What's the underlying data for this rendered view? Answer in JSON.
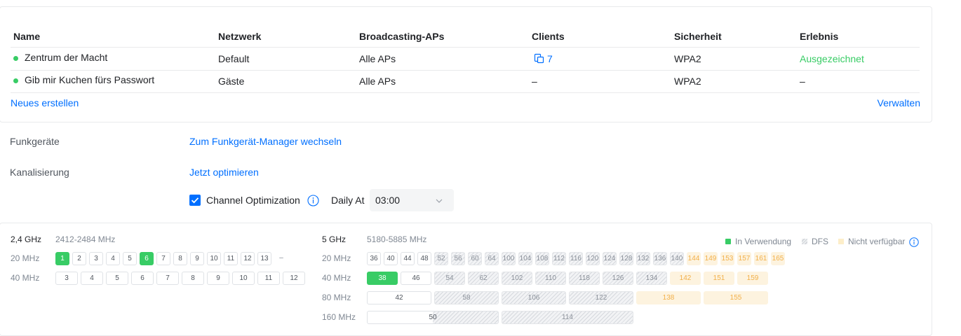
{
  "wifi_table": {
    "headers": {
      "name": "Name",
      "network": "Netzwerk",
      "aps": "Broadcasting-APs",
      "clients": "Clients",
      "security": "Sicherheit",
      "experience": "Erlebnis"
    },
    "rows": [
      {
        "name": "Zentrum der Macht",
        "network": "Default",
        "aps": "Alle APs",
        "clients": "7",
        "security": "WPA2",
        "experience": "Ausgezeichnet"
      },
      {
        "name": "Gib mir Kuchen fürs Passwort",
        "network": "Gäste",
        "aps": "Alle APs",
        "clients": "–",
        "security": "WPA2",
        "experience": "–"
      }
    ],
    "create_label": "Neues erstellen",
    "manage_label": "Verwalten"
  },
  "radios": {
    "label": "Funkgeräte",
    "link": "Zum Funkgerät-Manager wechseln"
  },
  "channelization": {
    "label": "Kanalisierung",
    "link": "Jetzt optimieren",
    "checkbox_label": "Channel Optimization",
    "checked": true,
    "daily_label": "Daily At",
    "time_value": "03:00"
  },
  "colors": {
    "in_use": "#38cc65",
    "link": "#006fff",
    "unavailable": "#fdf3df"
  },
  "band24": {
    "name": "2,4 GHz",
    "range": "2412-2484 MHz",
    "w20_label": "20 MHz",
    "w40_label": "40 MHz",
    "w20": [
      "1",
      "2",
      "3",
      "4",
      "5",
      "6",
      "7",
      "8",
      "9",
      "10",
      "11",
      "12",
      "13",
      "–"
    ],
    "w20_states": [
      "use",
      "n",
      "n",
      "n",
      "n",
      "use",
      "n",
      "n",
      "n",
      "n",
      "n",
      "n",
      "n",
      "plain"
    ],
    "w40": [
      "3",
      "4",
      "5",
      "6",
      "7",
      "8",
      "9",
      "10",
      "11",
      "12"
    ]
  },
  "band5": {
    "name": "5 GHz",
    "range": "5180-5885 MHz",
    "legend": {
      "in_use": "In Verwendung",
      "dfs": "DFS",
      "unavailable": "Nicht verfügbar"
    },
    "w20_label": "20 MHz",
    "w40_label": "40 MHz",
    "w80_label": "80 MHz",
    "w160_label": "160 MHz",
    "w20": [
      "36",
      "40",
      "44",
      "48",
      "52",
      "56",
      "60",
      "64",
      "100",
      "104",
      "108",
      "112",
      "116",
      "120",
      "124",
      "128",
      "132",
      "136",
      "140",
      "144",
      "149",
      "153",
      "157",
      "161",
      "165"
    ],
    "w20_states": [
      "n",
      "n",
      "n",
      "n",
      "dfs",
      "dfs",
      "dfs",
      "dfs",
      "dfs",
      "dfs",
      "dfs",
      "dfs",
      "dfs",
      "dfs",
      "dfs",
      "dfs",
      "dfs",
      "dfs",
      "dfs",
      "na",
      "na",
      "na",
      "na",
      "na",
      "na"
    ],
    "w40": [
      "38",
      "46",
      "54",
      "62",
      "102",
      "110",
      "118",
      "126",
      "134",
      "142",
      "151",
      "159"
    ],
    "w40_states": [
      "use",
      "n",
      "dfs",
      "dfs",
      "dfs",
      "dfs",
      "dfs",
      "dfs",
      "dfs",
      "na",
      "na",
      "na"
    ],
    "w80": [
      "42",
      "58",
      "106",
      "122",
      "138",
      "155"
    ],
    "w80_states": [
      "n",
      "dfs",
      "dfs",
      "dfs",
      "na",
      "na"
    ],
    "w160": [
      "50",
      "114"
    ],
    "w160_states": [
      "mixed",
      "dfs"
    ]
  }
}
